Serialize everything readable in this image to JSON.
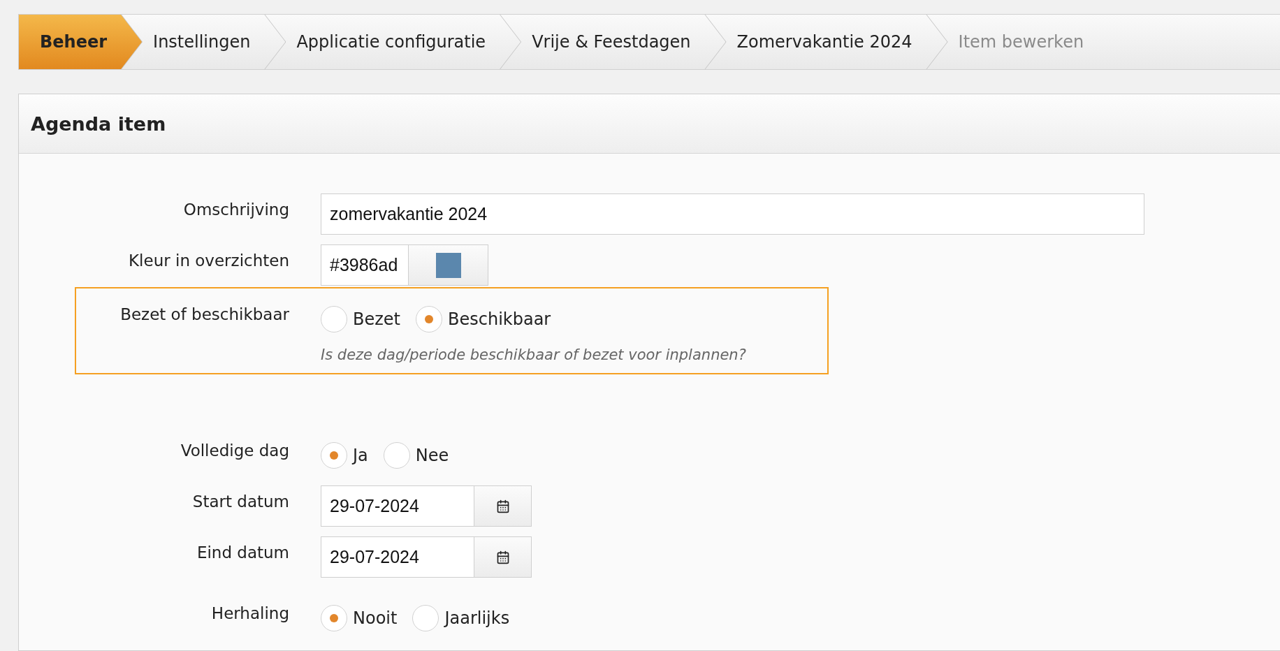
{
  "breadcrumb": [
    {
      "label": "Beheer",
      "kind": "root"
    },
    {
      "label": "Instellingen",
      "kind": "link"
    },
    {
      "label": "Applicatie configuratie",
      "kind": "link"
    },
    {
      "label": "Vrije & Feestdagen",
      "kind": "link"
    },
    {
      "label": "Zomervakantie 2024",
      "kind": "link"
    },
    {
      "label": "Item bewerken",
      "kind": "current"
    }
  ],
  "panel": {
    "title": "Agenda item",
    "fields": [
      {
        "kind": "text",
        "label": "Omschrijving",
        "value": "zomervakantie 2024"
      },
      {
        "kind": "color",
        "label": "Kleur in overzichten",
        "value": "#3986ad"
      },
      {
        "kind": "radio",
        "label": "Bezet of beschikbaar",
        "highlighted": true,
        "options": [
          {
            "label": "Bezet",
            "selected": false
          },
          {
            "label": "Beschikbaar",
            "selected": true
          }
        ],
        "hint": "Is deze dag/periode beschikbaar of bezet voor inplannen?"
      },
      {
        "kind": "radio",
        "label": "Volledige dag",
        "options": [
          {
            "label": "Ja",
            "selected": true
          },
          {
            "label": "Nee",
            "selected": false
          }
        ]
      },
      {
        "kind": "date",
        "label": "Start datum",
        "value": "29-07-2024"
      },
      {
        "kind": "date",
        "label": "Eind datum",
        "value": "29-07-2024"
      },
      {
        "kind": "radio",
        "label": "Herhaling",
        "options": [
          {
            "label": "Nooit",
            "selected": true
          },
          {
            "label": "Jaarlijks",
            "selected": false
          }
        ]
      }
    ]
  }
}
